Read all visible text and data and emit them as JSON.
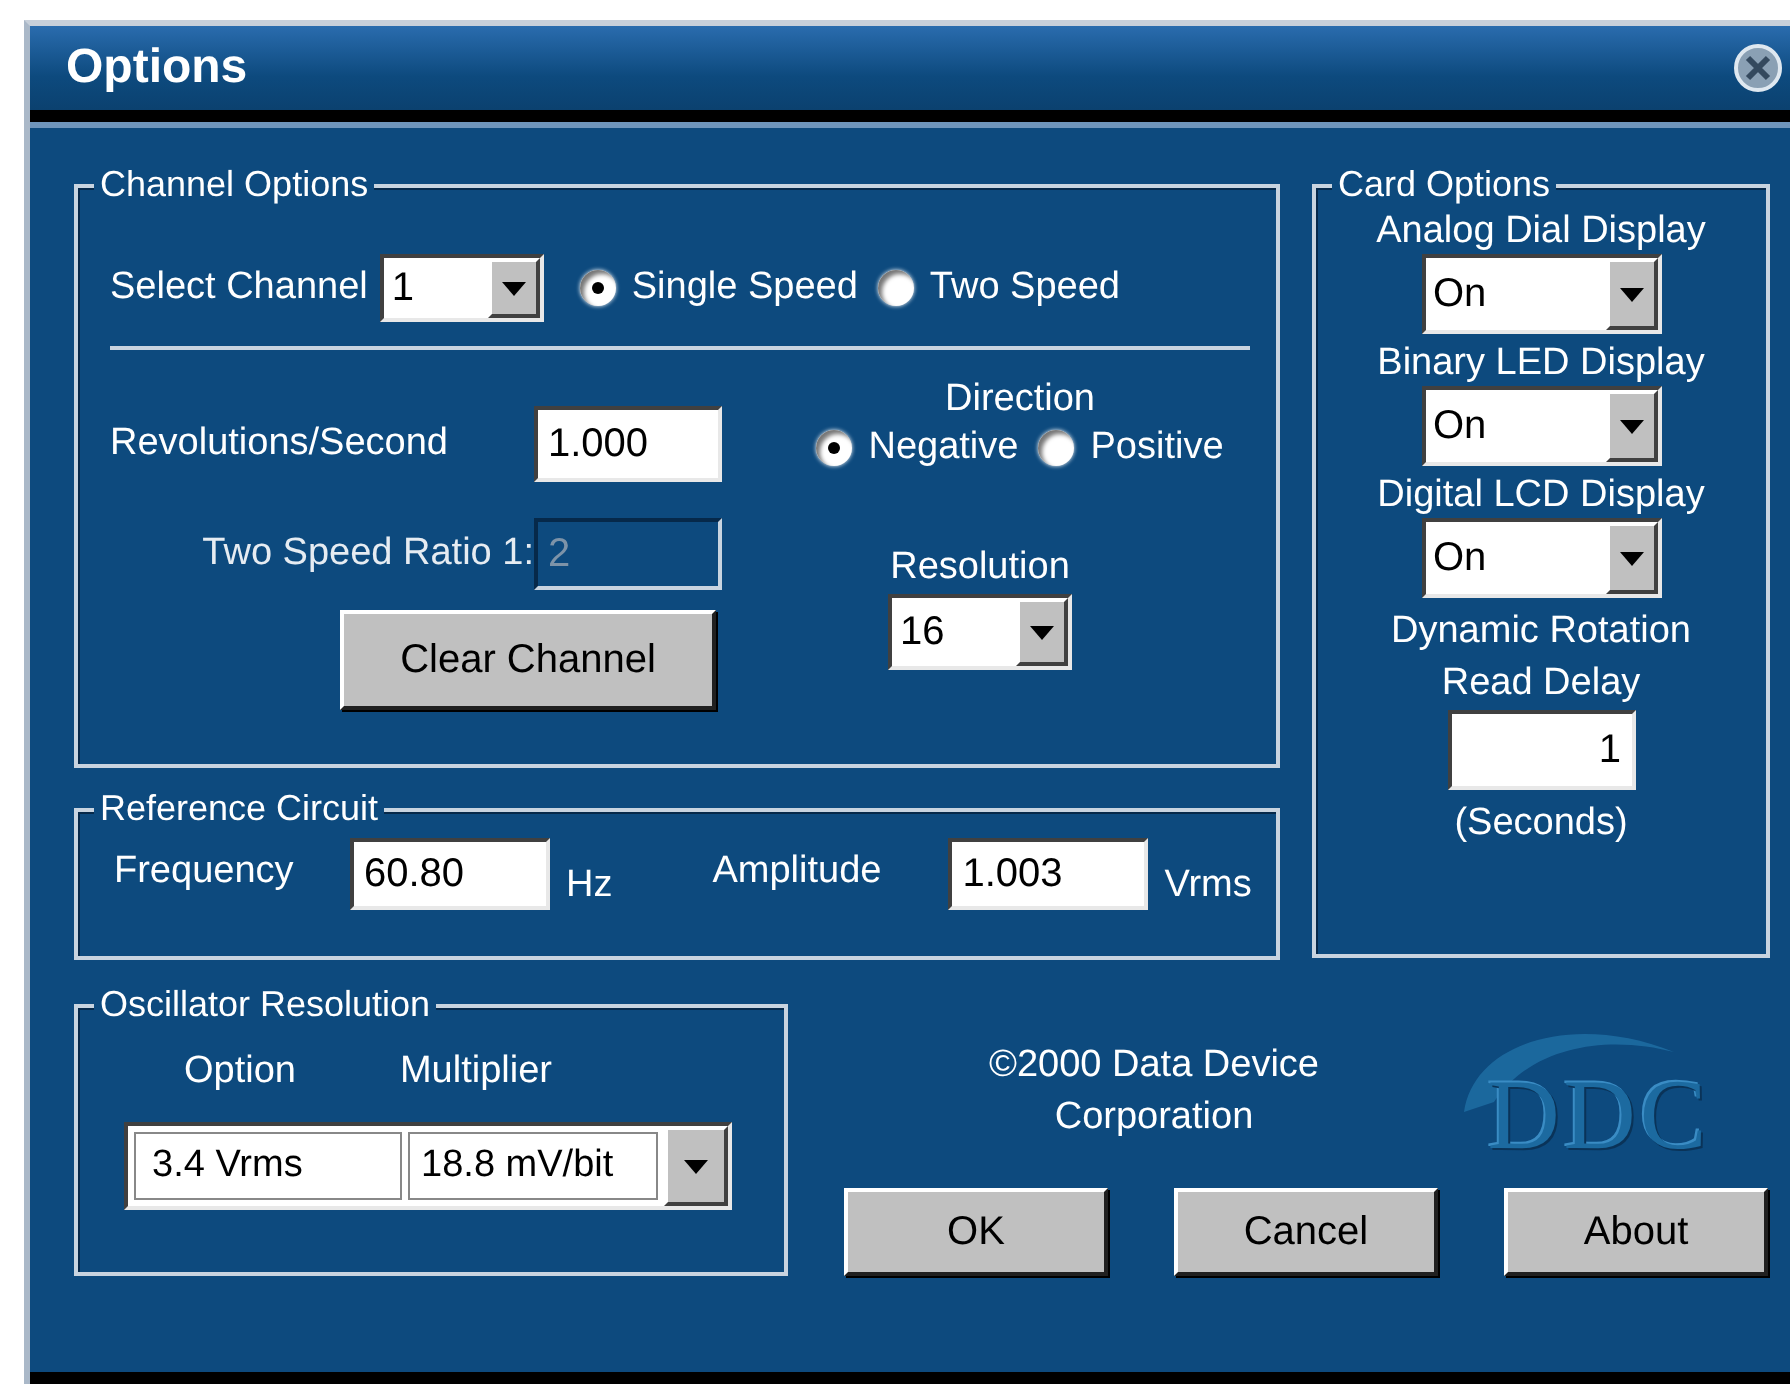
{
  "window": {
    "title": "Options"
  },
  "channel_options": {
    "title": "Channel Options",
    "select_channel": {
      "label": "Select Channel",
      "value": "1"
    },
    "speed": [
      {
        "label": "Single Speed",
        "selected": true
      },
      {
        "label": "Two Speed",
        "selected": false
      }
    ],
    "revolutions": {
      "label": "Revolutions/Second",
      "value": "1.000"
    },
    "direction": {
      "label": "Direction",
      "options": [
        {
          "label": "Negative",
          "selected": true
        },
        {
          "label": "Positive",
          "selected": false
        }
      ]
    },
    "two_speed_ratio": {
      "label": "Two Speed Ratio 1:",
      "value": "2",
      "disabled": true
    },
    "resolution": {
      "label": "Resolution",
      "value": "16"
    },
    "clear_button": "Clear Channel"
  },
  "reference_circuit": {
    "title": "Reference Circuit",
    "fields": [
      {
        "label": "Frequency",
        "value": "60.80",
        "unit": "Hz"
      },
      {
        "label": "Amplitude",
        "value": "1.003",
        "unit": "Vrms"
      }
    ]
  },
  "oscillator_resolution": {
    "title": "Oscillator Resolution",
    "columns": [
      "Option",
      "Multiplier"
    ],
    "option": "3.4 Vrms",
    "multiplier": "18.8 mV/bit"
  },
  "card_options": {
    "title": "Card Options",
    "displays": [
      {
        "label": "Analog Dial Display",
        "value": "On"
      },
      {
        "label": "Binary LED Display",
        "value": "On"
      },
      {
        "label": "Digital LCD Display",
        "value": "On"
      }
    ],
    "read_delay": {
      "label": "Dynamic Rotation Read Delay",
      "value": "1",
      "unit": "(Seconds)"
    }
  },
  "copyright": "©2000 Data Device Corporation",
  "logo": {
    "text": "DDC"
  },
  "buttons": [
    "OK",
    "Cancel",
    "About"
  ]
}
